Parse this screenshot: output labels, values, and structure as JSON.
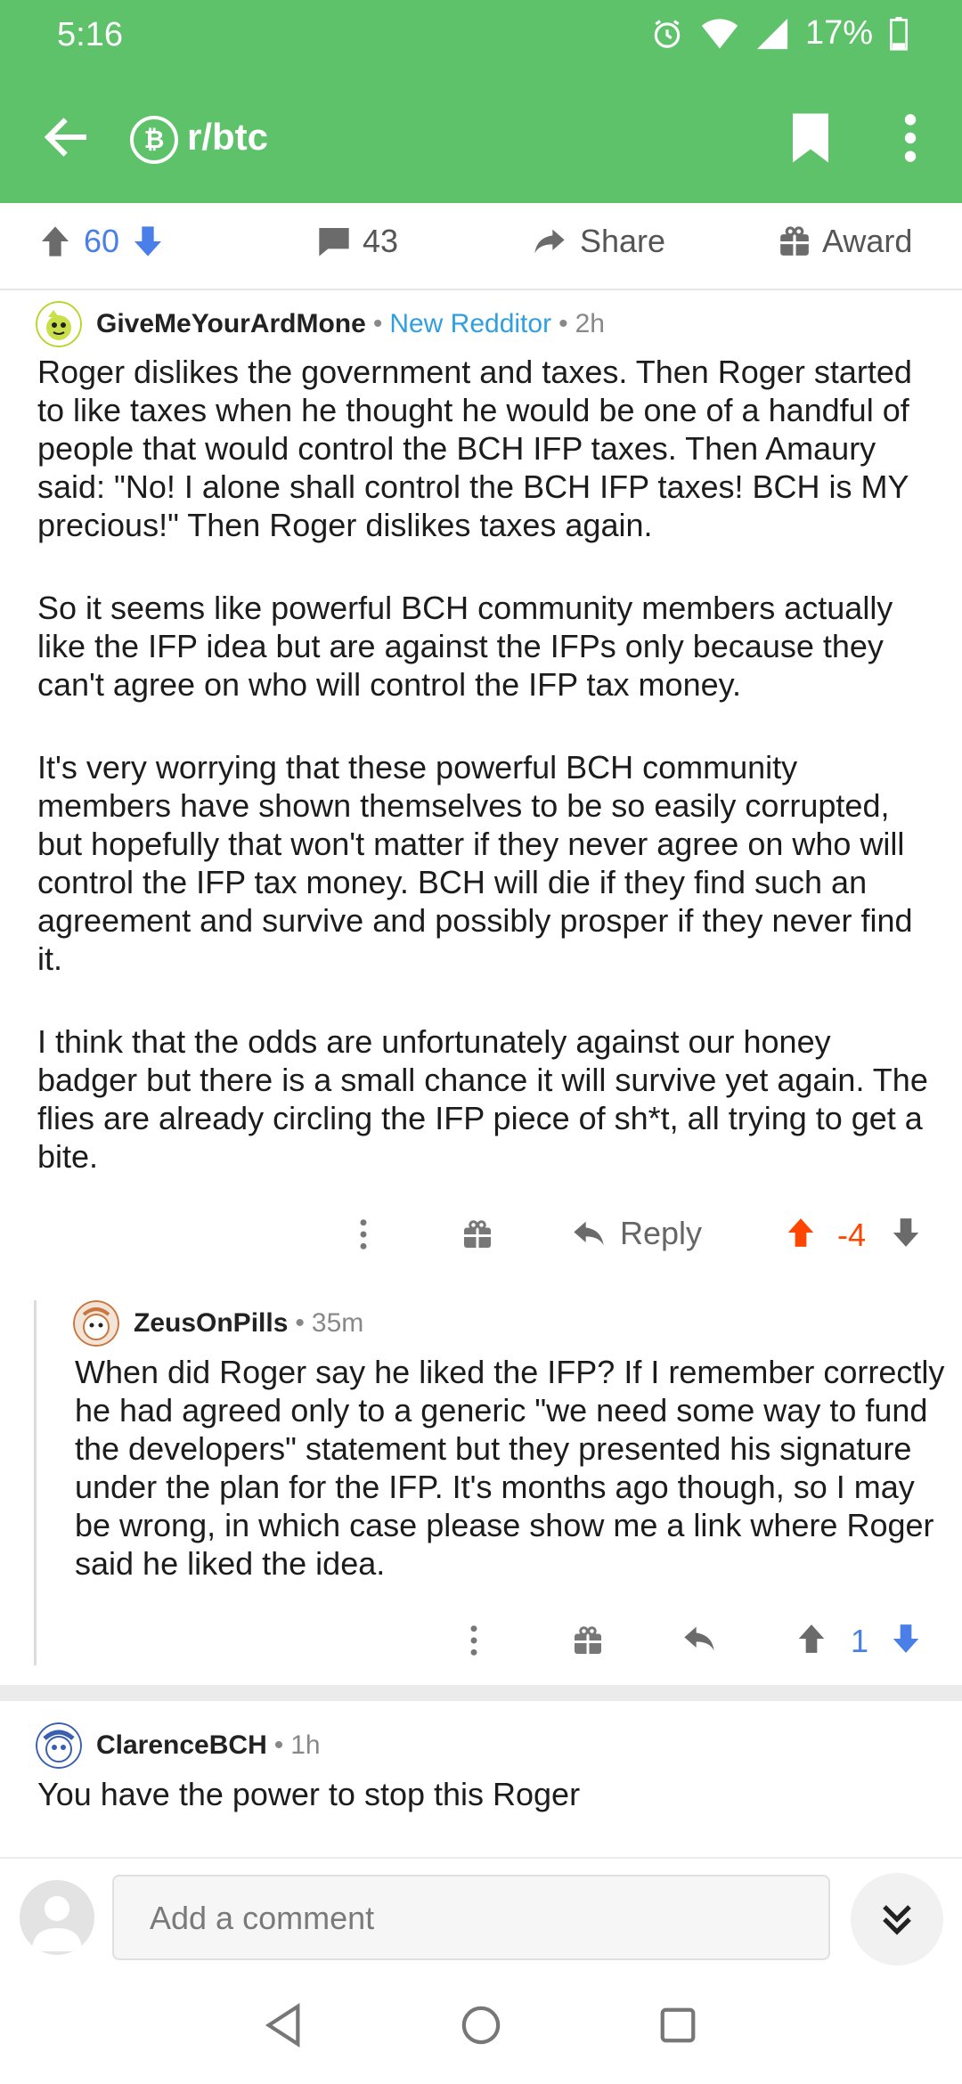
{
  "status_bar": {
    "time": "5:16",
    "battery": "17%"
  },
  "header": {
    "subreddit": "r/btc",
    "subreddit_icon": "bitcoin-icon"
  },
  "post_actions": {
    "upvotes": "60",
    "comments": "43",
    "share_label": "Share",
    "award_label": "Award"
  },
  "comments": [
    {
      "username": "GiveMeYourArdMone",
      "flair": "New Redditor",
      "age": "2h",
      "paragraphs": [
        "Roger dislikes the government and taxes. Then Roger started to like taxes when he thought he would be one of a handful of people that would control the BCH IFP taxes. Then Amaury said: \"No! I alone shall control the BCH IFP taxes! BCH is MY precious!\" Then Roger dislikes taxes again.",
        "So it seems like powerful BCH community members actually like the IFP idea but are against the IFPs only because they can't agree on who will control the IFP tax money.",
        "It's very worrying that these powerful BCH community members have shown themselves to be so easily corrupted, but hopefully that won't matter if they never agree on who will control the IFP tax money. BCH will die if they find such an agreement and survive and possibly prosper if they never find it.",
        "I think that the odds are unfortunately against our honey badger but there is a small chance it will survive yet again. The flies are already circling the IFP piece of sh*t, all trying to get a bite."
      ],
      "reply_label": "Reply",
      "score": "-4"
    },
    {
      "username": "ZeusOnPills",
      "age": "35m",
      "paragraphs": [
        "When did Roger say he liked the IFP? If I remember correctly he had agreed only to a generic \"we need some way to fund the developers\" statement but they presented his signature under the plan for the IFP. It's months ago though, so I may be wrong, in which case please show me a link where Roger said he liked the idea."
      ],
      "score": "1"
    },
    {
      "username": "ClarenceBCH",
      "age": "1h",
      "paragraphs": [
        "You have the power to stop this Roger"
      ]
    }
  ],
  "compose": {
    "placeholder": "Add a comment"
  },
  "colors": {
    "header_green": "#5ec26a",
    "upvote_orange": "#ff4500",
    "vote_blue": "#4a7ee8",
    "flair_blue": "#2f9fe0"
  }
}
